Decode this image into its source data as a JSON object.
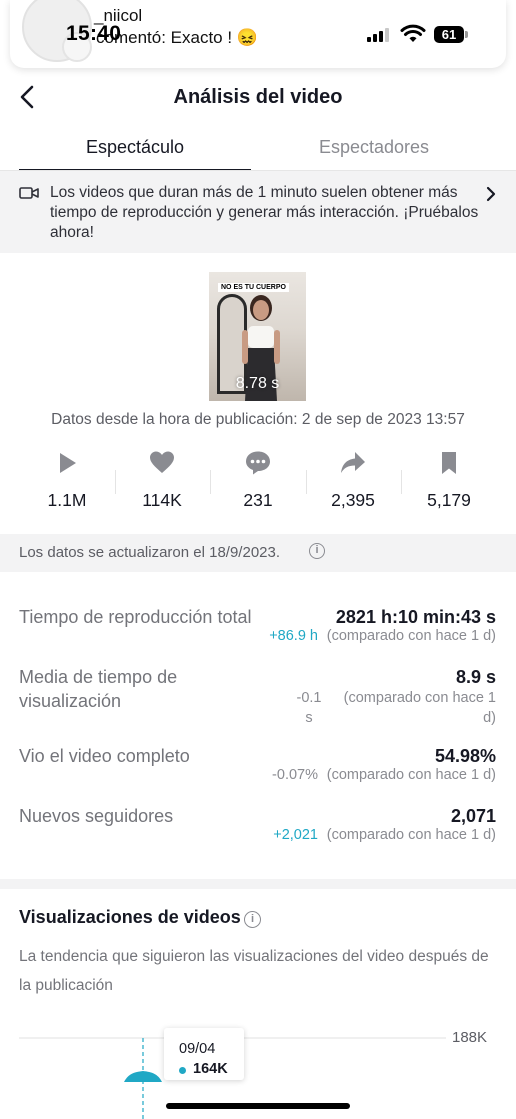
{
  "status_bar": {
    "time": "15:40",
    "battery": "61"
  },
  "notification": {
    "user": "_niicol",
    "message": "comentó: Exacto ! 😖"
  },
  "header": {
    "title": "Análisis del video"
  },
  "tabs": [
    {
      "label": "Espectáculo",
      "active": true
    },
    {
      "label": "Espectadores",
      "active": false
    }
  ],
  "promo": {
    "text": "Los videos que duran más de 1 minuto suelen obtener más tiempo de reproducción y generar más interacción. ¡Pruébalos ahora!"
  },
  "video": {
    "caption": "NO ES TU CUERPO",
    "duration": "8.78 s",
    "since": "Datos desde la hora de publicación: 2 de sep de 2023 13:57"
  },
  "stats": [
    {
      "icon": "play-icon",
      "value": "1.1M"
    },
    {
      "icon": "heart-icon",
      "value": "114K"
    },
    {
      "icon": "comment-icon",
      "value": "231"
    },
    {
      "icon": "share-icon",
      "value": "2,395"
    },
    {
      "icon": "bookmark-icon",
      "value": "5,179"
    }
  ],
  "updated": {
    "text": "Los datos se actualizaron el 18/9/2023."
  },
  "metrics": [
    {
      "label": "Tiempo de reproducción total",
      "value": "2821 h:10 min:43 s",
      "delta": "+86.9 h",
      "compare": "(comparado con hace 1 d)"
    },
    {
      "label": "Media de tiempo de visualización",
      "value": "8.9 s",
      "delta": "-0.1 s",
      "compare": "(comparado con hace 1 d)"
    },
    {
      "label": "Vio el video completo",
      "value": "54.98%",
      "delta": "-0.07%",
      "compare": "(comparado con hace 1 d)"
    },
    {
      "label": "Nuevos seguidores",
      "value": "2,071",
      "delta": "+2,021",
      "compare": "(comparado con hace 1 d)"
    }
  ],
  "views_section": {
    "title": "Visualizaciones de videos",
    "description": "La tendencia que siguieron las visualizaciones del video después de la publicación",
    "y_max_label": "188K",
    "tooltip": {
      "date": "09/04",
      "value": "164K"
    }
  },
  "colors": {
    "accent": "#20a8c5",
    "text": "#161823",
    "muted": "#8a8b91"
  }
}
